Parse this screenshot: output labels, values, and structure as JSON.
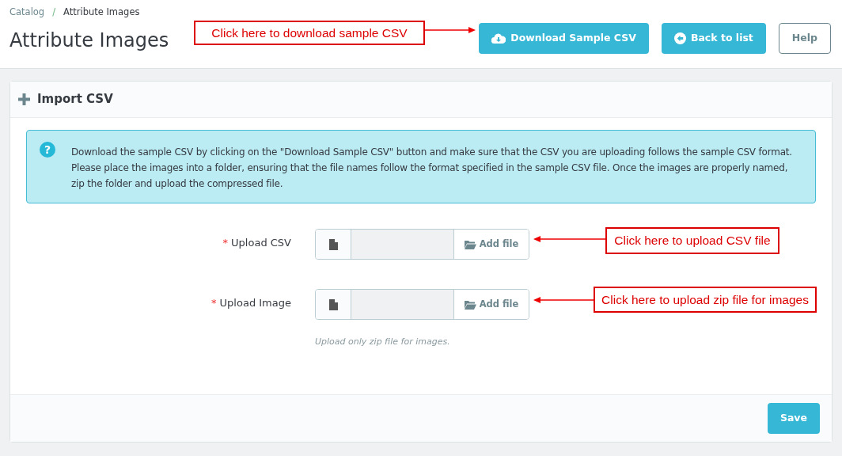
{
  "breadcrumb": [
    "Catalog",
    "Attribute Images"
  ],
  "breadcrumb_separator": "/",
  "title": "Attribute Images",
  "toolbar": [
    {
      "label": "Download Sample CSV",
      "kind": "download"
    },
    {
      "label": "Back to list",
      "kind": "back"
    },
    {
      "label": "Help",
      "kind": "plain"
    }
  ],
  "panel": {
    "title": "Import CSV",
    "info_icon": "?",
    "info": "Download the sample CSV by clicking on the \"Download Sample CSV\" button and make sure that the CSV you are uploading follows the sample CSV format. Please place the images into a folder, ensuring that the file names follow the format specified in the sample CSV file. Once the images are properly named, zip the folder and upload the compressed file.",
    "fields": [
      {
        "label": "Upload CSV",
        "required_mark": "*",
        "button": "Add file"
      },
      {
        "label": "Upload Image",
        "required_mark": "*",
        "button": "Add file",
        "help": "Upload only zip file for images."
      }
    ],
    "save": "Save"
  },
  "annotations": [
    "Click here to download sample CSV",
    "Click here to upload CSV file",
    "Click here to upload zip file for images"
  ]
}
